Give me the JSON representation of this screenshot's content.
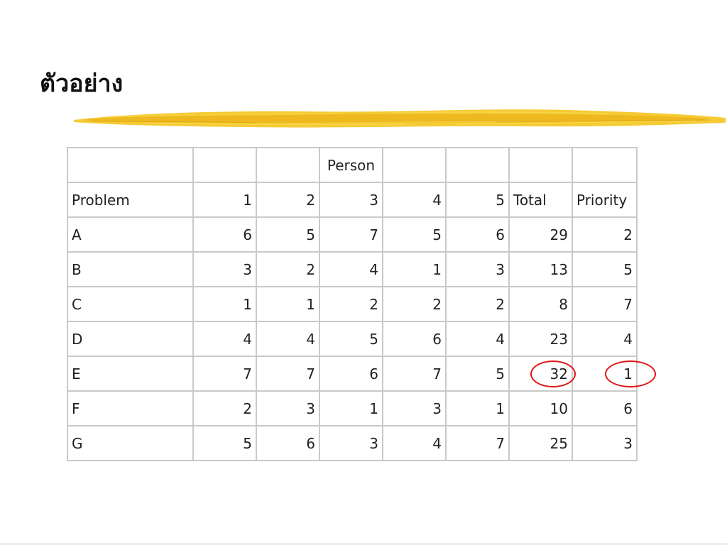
{
  "slide": {
    "title": "ตัวอย่าง"
  },
  "table": {
    "group_header": [
      "",
      "",
      "",
      "Person",
      "",
      "",
      "",
      ""
    ],
    "columns": [
      "Problem",
      "1",
      "2",
      "3",
      "4",
      "5",
      "Total",
      "Priority"
    ],
    "rows": [
      {
        "problem": "A",
        "scores": [
          "6",
          "5",
          "7",
          "5",
          "6"
        ],
        "total": "29",
        "priority": "2",
        "highlighted": false
      },
      {
        "problem": "B",
        "scores": [
          "3",
          "2",
          "4",
          "1",
          "3"
        ],
        "total": "13",
        "priority": "5",
        "highlighted": false
      },
      {
        "problem": "C",
        "scores": [
          "1",
          "1",
          "2",
          "2",
          "2"
        ],
        "total": "8",
        "priority": "7",
        "highlighted": false
      },
      {
        "problem": "D",
        "scores": [
          "4",
          "4",
          "5",
          "6",
          "4"
        ],
        "total": "23",
        "priority": "4",
        "highlighted": false
      },
      {
        "problem": "E",
        "scores": [
          "7",
          "7",
          "6",
          "7",
          "5"
        ],
        "total": "32",
        "priority": "1",
        "highlighted": true
      },
      {
        "problem": "F",
        "scores": [
          "2",
          "3",
          "1",
          "3",
          "1"
        ],
        "total": "10",
        "priority": "6",
        "highlighted": false
      },
      {
        "problem": "G",
        "scores": [
          "5",
          "6",
          "3",
          "4",
          "7"
        ],
        "total": "25",
        "priority": "3",
        "highlighted": false
      }
    ]
  },
  "colors": {
    "highlight": "#e01414",
    "brush": "#f2c21b",
    "grid": "#c9c9c9"
  }
}
